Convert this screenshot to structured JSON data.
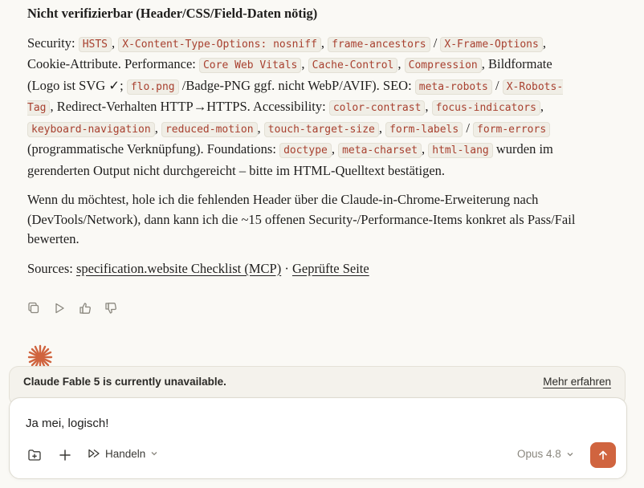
{
  "message": {
    "heading": "Nicht verifizierbar (Header/CSS/Field-Daten nötig)",
    "p1": {
      "t0": "Security: ",
      "c_hsts": "HSTS",
      "t1": ", ",
      "c_xcto": "X-Content-Type-Options: nosniff",
      "t2": ", ",
      "c_fa": "frame-ancestors",
      "t3": " / ",
      "c_xfo": "X-Frame-Options",
      "t4": ", Cookie-Attribute. Performance: ",
      "c_cwv": "Core Web Vitals",
      "t5": ", ",
      "c_cc": "Cache-Control",
      "t6": ", ",
      "c_comp": "Compression",
      "t7": ", Bildformate (Logo ist SVG ✓; ",
      "c_flo": "flo.png",
      "t8": " /Badge-PNG ggf. nicht WebP/AVIF). SEO: ",
      "c_mr": "meta-robots",
      "t9": " / ",
      "c_xrt": "X-Robots-Tag",
      "t10": ", Redirect-Verhalten HTTP→HTTPS. Accessibility: ",
      "c_ccon": "color-contrast",
      "t11": ", ",
      "c_fi": "focus-indicators",
      "t12": ", ",
      "c_kn": "keyboard-navigation",
      "t13": ", ",
      "c_rm": "reduced-motion",
      "t14": ", ",
      "c_tts": "touch-target-size",
      "t15": ", ",
      "c_fl": "form-labels",
      "t16": " / ",
      "c_fe": "form-errors",
      "t17": " (programmatische Verknüpfung). Foundations: ",
      "c_dt": "doctype",
      "t18": ", ",
      "c_mc": "meta-charset",
      "t19": ", ",
      "c_hl": "html-lang",
      "t20": " wurden im gerenderten Output nicht durchgereicht – bitte im HTML-Quelltext bestätigen."
    },
    "p2": "Wenn du möchtest, hole ich die fehlenden Header über die Claude-in-Chrome-Erweiterung nach (DevTools/Network), dann kann ich die ~15 offenen Security-/Performance-Items konkret als Pass/Fail bewerten.",
    "sources": {
      "label": "Sources: ",
      "link1": "specification.website Checklist (MCP)",
      "sep": " · ",
      "link2": "Geprüfte Seite"
    }
  },
  "actions": {
    "icons": [
      "copy-icon",
      "retry-icon",
      "thumbs-up-icon",
      "thumbs-down-icon"
    ]
  },
  "banner": {
    "text": "Claude Fable 5 is currently unavailable.",
    "link": "Mehr erfahren"
  },
  "composer": {
    "value": "Ja mei, logisch!",
    "mode_label": "Handeln",
    "model_label": "Opus 4.8"
  },
  "colors": {
    "accent": "#d0643f",
    "code_text": "#a8402f",
    "background": "#faf9f5"
  }
}
